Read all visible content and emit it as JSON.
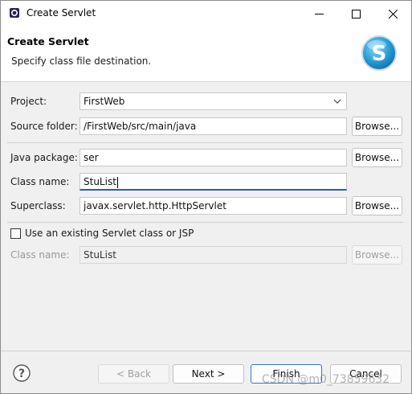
{
  "window": {
    "title": "Create Servlet"
  },
  "banner": {
    "title": "Create Servlet",
    "message": "Specify class file destination."
  },
  "form": {
    "project": {
      "label": "Project:",
      "value": "FirstWeb"
    },
    "source_folder": {
      "label": "Source folder:",
      "value": "/FirstWeb/src/main/java",
      "button": "Browse..."
    },
    "java_package": {
      "label": "Java package:",
      "value": "ser",
      "button": "Browse..."
    },
    "class_name": {
      "label": "Class name:",
      "value": "StuList"
    },
    "superclass": {
      "label": "Superclass:",
      "value": "javax.servlet.http.HttpServlet",
      "button": "Browse..."
    },
    "use_existing": {
      "label": "Use an existing Servlet class or JSP",
      "checked": false
    },
    "existing_class_name": {
      "label": "Class name:",
      "value": "StuList",
      "button": "Browse..."
    }
  },
  "footer": {
    "back": "< Back",
    "next": "Next >",
    "finish": "Finish",
    "cancel": "Cancel"
  },
  "watermark": "CSDN @m0_73859632",
  "icons": {
    "app": "eclipse-icon",
    "minimize": "minimize-icon",
    "maximize": "maximize-icon",
    "close": "close-icon",
    "logo": "servlet-logo-icon",
    "help": "help-icon",
    "dropdown": "chevron-down-icon"
  },
  "colors": {
    "accent": "#1f5fbf",
    "logo": "#2a9fd8"
  }
}
